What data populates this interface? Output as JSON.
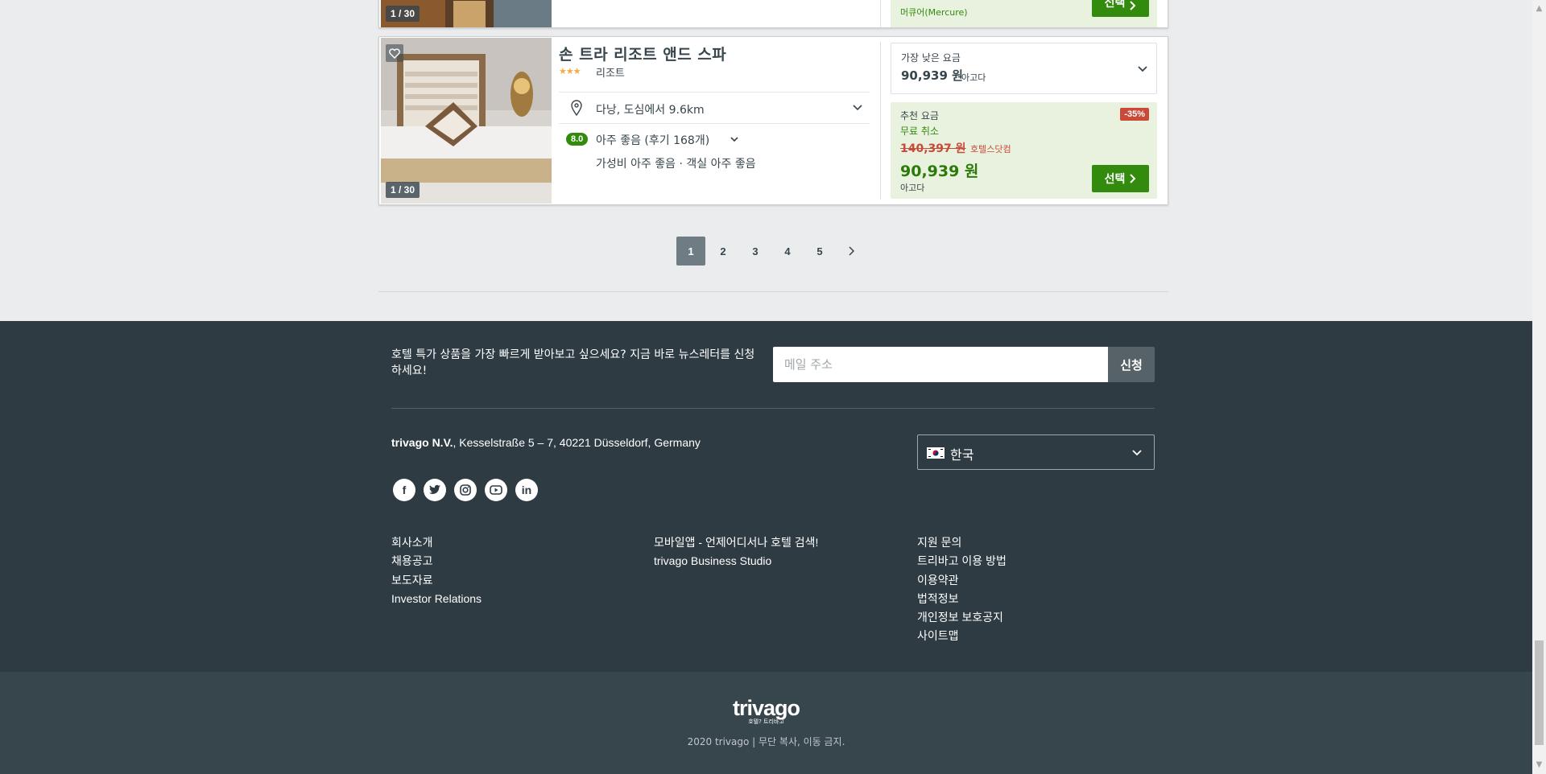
{
  "prev_card": {
    "image_counter": "1 / 30",
    "site": "머큐어(Mercure)",
    "select_label": "선택"
  },
  "hotel": {
    "name": "손 트라 리조트 앤드 스파",
    "stars": "★★★",
    "star_count": 3,
    "type": "리조트",
    "image_counter": "1 / 30",
    "location": "다낭, 도심에서 9.6km",
    "rating_score": "8.0",
    "rating_text": "아주 좋음 (후기 168개)",
    "sub_ratings": "가성비 아주 좋음 · 객실 아주 좋음",
    "lowest_label": "가장 낮은 요금",
    "lowest_price": "90,939 원",
    "lowest_site": "아고다",
    "deal_label": "추천 요금",
    "discount": "-35%",
    "free_cancel": "무료 취소",
    "old_price": "140,397 원",
    "old_site": "호텔스닷컴",
    "new_price": "90,939 원",
    "new_site": "아고다",
    "select_label": "선택"
  },
  "pagination": {
    "pages": [
      "1",
      "2",
      "3",
      "4",
      "5"
    ],
    "active": "1"
  },
  "footer": {
    "newsletter_text": "호텔 특가 상품을 가장 빠르게 받아보고 싶으세요? 지금 바로 뉴스레터를 신청하세요!",
    "email_placeholder": "메일 주소",
    "subscribe_label": "신청",
    "company": "trivago N.V.",
    "address": ", Kesselstraße 5 – 7, 40221 Düsseldorf, Germany",
    "language": "한국",
    "social": [
      "facebook-icon",
      "twitter-icon",
      "instagram-icon",
      "youtube-icon",
      "linkedin-icon"
    ],
    "col1": [
      "회사소개",
      "채용공고",
      "보도자료",
      "Investor Relations"
    ],
    "col2": [
      "모바일앱 - 언제어디서나 호텔 검색!",
      "trivago Business Studio"
    ],
    "col3": [
      "지원 문의",
      "트리바고 이용 방법",
      "이용약관",
      "법적정보",
      "개인정보 보호공지",
      "사이트맵"
    ],
    "logo": "trivago",
    "logo_tag": "호텔? 트리바고",
    "copyright": "2020 trivago | 무단 복사, 이동 금지."
  },
  "colors": {
    "accent_green": "#328b0d",
    "discount_red": "#c94a38",
    "footer_bg": "#2e3b42"
  }
}
